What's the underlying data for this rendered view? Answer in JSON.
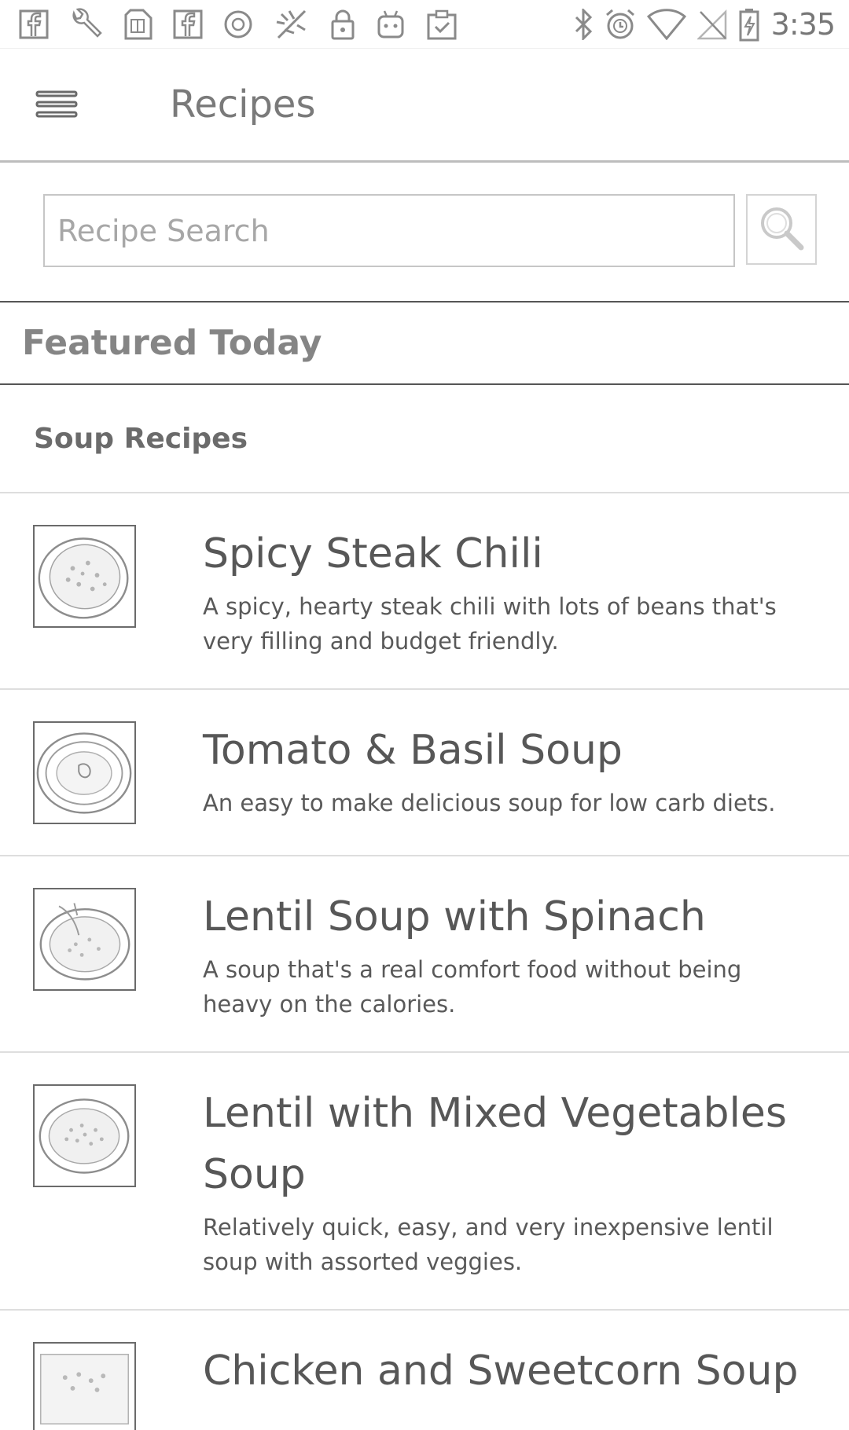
{
  "status_bar": {
    "left_icons": [
      "facebook-icon",
      "wrench-icon",
      "sim-card-icon",
      "facebook-icon",
      "circle-badge-icon",
      "food-app-icon",
      "lock-icon",
      "robot-icon",
      "clipboard-check-icon"
    ],
    "right_icons": [
      "bluetooth-icon",
      "alarm-icon",
      "wifi-icon",
      "no-signal-icon",
      "battery-charging-icon"
    ],
    "time": "3:35"
  },
  "app_bar": {
    "menu_icon": "hamburger-menu-icon",
    "title": "Recipes"
  },
  "search": {
    "placeholder": "Recipe Search",
    "value": "",
    "button_icon": "search-icon"
  },
  "featured": {
    "label": "Featured Today"
  },
  "section": {
    "title": "Soup Recipes"
  },
  "recipes": [
    {
      "title": "Spicy Steak Chili",
      "description": "A spicy, hearty steak chili with lots of beans that's very filling and budget friendly.",
      "thumbnail_icon": "chili-bowl-image"
    },
    {
      "title": "Tomato & Basil Soup",
      "description": "An easy to make delicious soup for low carb diets.",
      "thumbnail_icon": "tomato-soup-bowl-image"
    },
    {
      "title": "Lentil Soup with Spinach",
      "description": "A soup that's a real comfort food without being heavy on the calories.",
      "thumbnail_icon": "lentil-soup-bowl-image"
    },
    {
      "title": "Lentil with Mixed Vegetables Soup",
      "description": "Relatively quick, easy, and very inexpensive lentil soup with assorted veggies.",
      "thumbnail_icon": "vegetable-soup-bowl-image"
    },
    {
      "title": "Chicken and Sweetcorn Soup",
      "description": "",
      "thumbnail_icon": "chicken-soup-bowl-image"
    }
  ]
}
